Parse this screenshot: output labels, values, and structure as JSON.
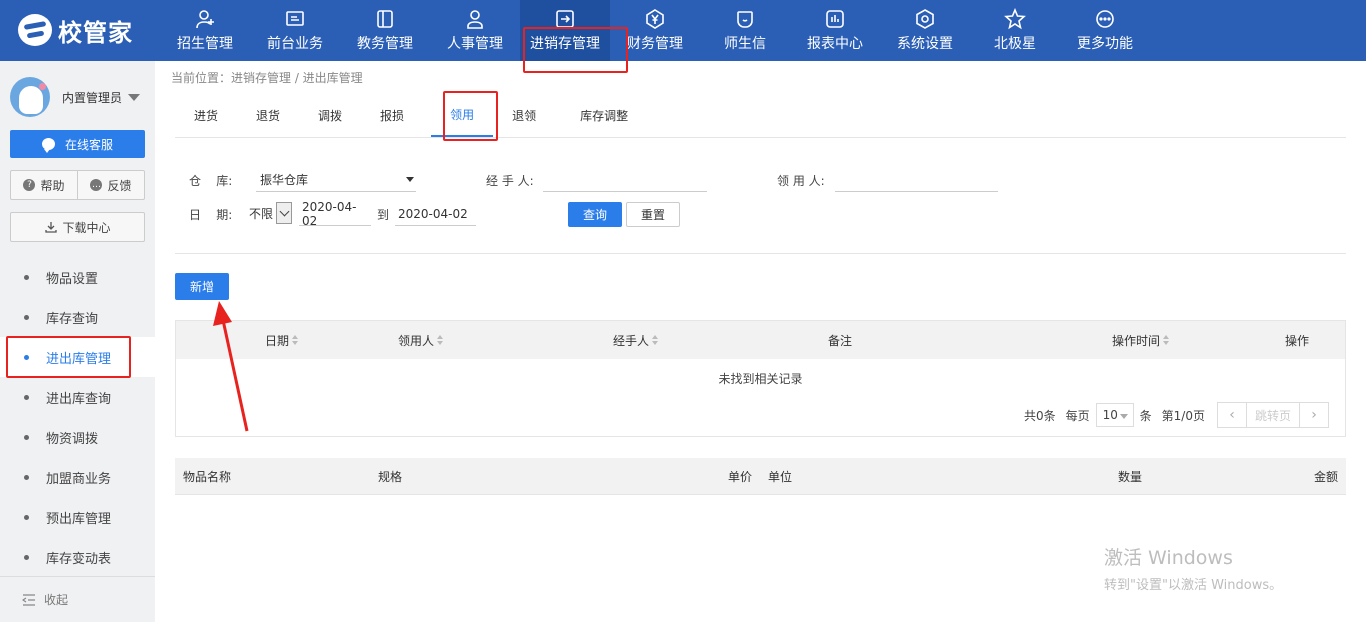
{
  "app": {
    "logo_text": "校管家"
  },
  "nav": {
    "items": [
      {
        "label": "招生管理",
        "icon": "person-plus-icon"
      },
      {
        "label": "前台业务",
        "icon": "monitor-icon"
      },
      {
        "label": "教务管理",
        "icon": "book-icon"
      },
      {
        "label": "人事管理",
        "icon": "user-icon"
      },
      {
        "label": "进销存管理",
        "icon": "arrow-in-box-icon",
        "active": true
      },
      {
        "label": "财务管理",
        "icon": "yen-icon"
      },
      {
        "label": "师生信",
        "icon": "chat-icon"
      },
      {
        "label": "报表中心",
        "icon": "bar-chart-icon"
      },
      {
        "label": "系统设置",
        "icon": "settings-icon"
      },
      {
        "label": "北极星",
        "icon": "star-icon"
      },
      {
        "label": "更多功能",
        "icon": "more-icon"
      }
    ]
  },
  "sidebar": {
    "user_name": "内置管理员",
    "service_button": "在线客服",
    "help_button": "帮助",
    "feedback_button": "反馈",
    "download_button": "下载中心",
    "menu": [
      {
        "label": "物品设置"
      },
      {
        "label": "库存查询"
      },
      {
        "label": "进出库管理",
        "active": true
      },
      {
        "label": "进出库查询"
      },
      {
        "label": "物资调拨"
      },
      {
        "label": "加盟商业务"
      },
      {
        "label": "预出库管理"
      },
      {
        "label": "库存变动表"
      }
    ],
    "collapse_label": "收起"
  },
  "breadcrumb": "当前位置：进销存管理 / 进出库管理",
  "tabs": [
    {
      "label": "进货"
    },
    {
      "label": "退货"
    },
    {
      "label": "调拨"
    },
    {
      "label": "报损"
    },
    {
      "label": "领用",
      "active": true
    },
    {
      "label": "退领"
    },
    {
      "label": "库存调整"
    }
  ],
  "filters": {
    "warehouse_label": "仓    库:",
    "warehouse_value": "振华仓库",
    "handler_label": "经 手 人:",
    "handler_value": "",
    "receiver_label": "领 用 人:",
    "receiver_value": "",
    "date_label": "日    期:",
    "date_range_option": "不限",
    "date_start": "2020-04-02",
    "date_to": "到",
    "date_end": "2020-04-02",
    "query_button": "查询",
    "reset_button": "重置"
  },
  "add_button": "新增",
  "records_table": {
    "columns": [
      "日期",
      "领用人",
      "经手人",
      "备注",
      "操作时间",
      "操作"
    ],
    "empty_text": "未找到相关记录",
    "pager": {
      "total_text": "共0条",
      "per_page_label": "每页",
      "per_page_value": "10",
      "per_page_unit": "条",
      "page_text": "第1/0页",
      "prev": "‹",
      "jump_label": "跳转页",
      "next": "›"
    }
  },
  "items_table": {
    "columns": [
      "物品名称",
      "规格",
      "单价",
      "单位",
      "数量",
      "金额"
    ]
  },
  "watermark": {
    "line1": "激活 Windows",
    "line2": "转到\"设置\"以激活 Windows。"
  },
  "colors": {
    "topbar": "#2b5fb5",
    "accent": "#2b7de9",
    "highlight": "#e8231f"
  }
}
